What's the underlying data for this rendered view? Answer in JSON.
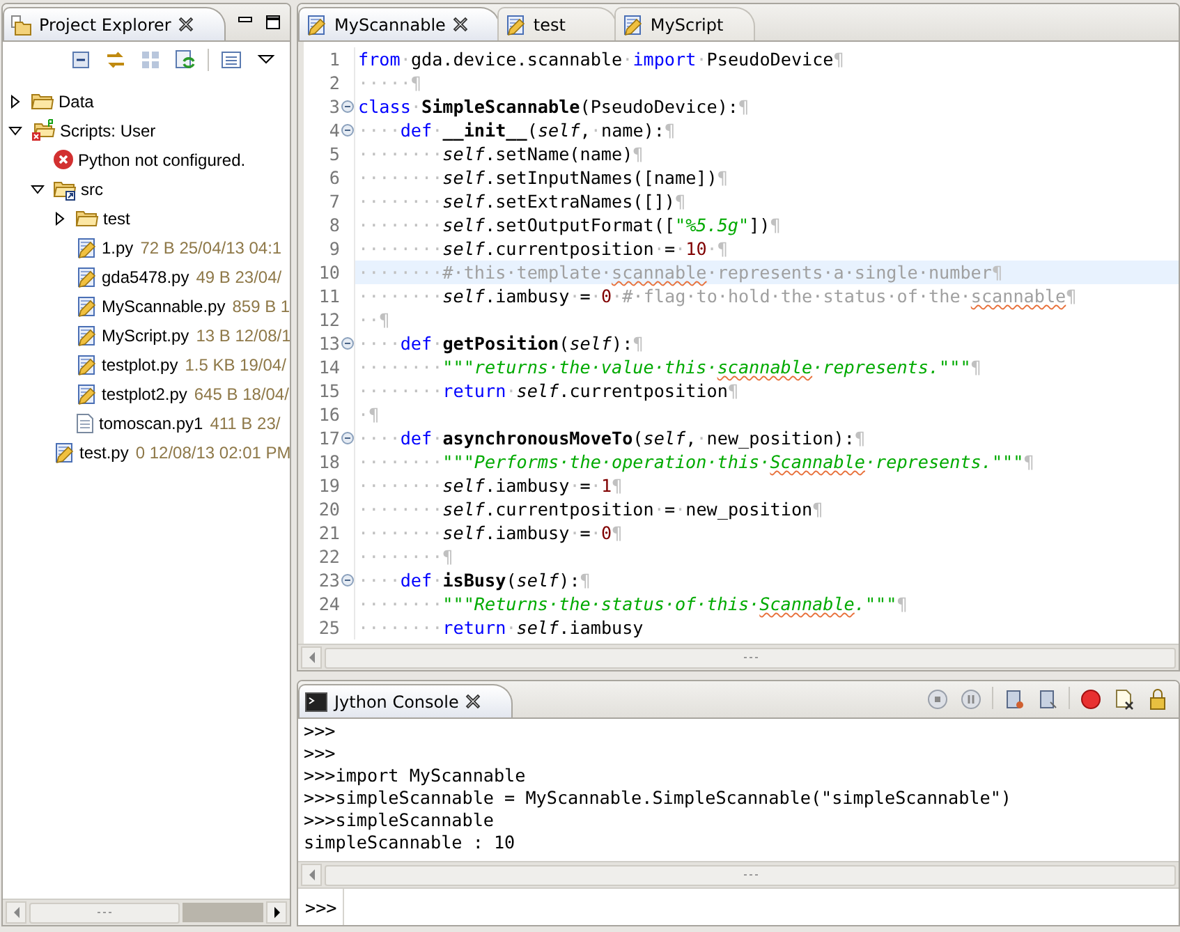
{
  "explorer": {
    "title": "Project Explorer",
    "tree": [
      {
        "label": "Data",
        "kind": "folder",
        "expanded": false
      },
      {
        "label": "Scripts: User",
        "kind": "project",
        "expanded": true,
        "children": [
          {
            "label": "Python not configured.",
            "kind": "error"
          },
          {
            "label": "src",
            "kind": "source-folder",
            "expanded": true,
            "children": [
              {
                "label": "test",
                "kind": "folder",
                "expanded": false
              },
              {
                "label": "1.py",
                "detail": "72 B 25/04/13 04:1",
                "kind": "python-file"
              },
              {
                "label": "gda5478.py",
                "detail": "49 B 23/04/",
                "kind": "python-file"
              },
              {
                "label": "MyScannable.py",
                "detail": "859 B 1",
                "kind": "python-file"
              },
              {
                "label": "MyScript.py",
                "detail": "13 B 12/08/1",
                "kind": "python-file"
              },
              {
                "label": "testplot.py",
                "detail": "1.5 KB 19/04/",
                "kind": "python-file"
              },
              {
                "label": "testplot2.py",
                "detail": "645 B 18/04/",
                "kind": "python-file"
              },
              {
                "label": "tomoscan.py1",
                "detail": "411 B 23/",
                "kind": "text-file"
              }
            ]
          },
          {
            "label": "test.py",
            "detail": "0 12/08/13 02:01 PM",
            "kind": "python-file"
          }
        ]
      }
    ]
  },
  "editor": {
    "tabs": [
      {
        "label": "MyScannable",
        "selected": true
      },
      {
        "label": "test",
        "selected": false
      },
      {
        "label": "MyScript",
        "selected": false
      }
    ],
    "lines": [
      {
        "number": "1",
        "fold": false,
        "current": false,
        "tokens": [
          {
            "kind": "keyword",
            "text": "from"
          },
          {
            "kind": "space",
            "text": "·"
          },
          {
            "kind": "plain",
            "text": "gda.device.scannable"
          },
          {
            "kind": "space",
            "text": "·"
          },
          {
            "kind": "keyword",
            "text": "import"
          },
          {
            "kind": "space",
            "text": "·"
          },
          {
            "kind": "plain",
            "text": "PseudoDevice"
          },
          {
            "kind": "space",
            "text": "¶"
          }
        ]
      },
      {
        "number": "2",
        "fold": false,
        "current": false,
        "tokens": [
          {
            "kind": "space",
            "text": "·····¶"
          }
        ]
      },
      {
        "number": "3",
        "fold": true,
        "current": false,
        "tokens": [
          {
            "kind": "keyword",
            "text": "class"
          },
          {
            "kind": "space",
            "text": "·"
          },
          {
            "kind": "name",
            "text": "SimpleScannable"
          },
          {
            "kind": "plain",
            "text": "(PseudoDevice):"
          },
          {
            "kind": "space",
            "text": "¶"
          }
        ]
      },
      {
        "number": "4",
        "fold": true,
        "current": false,
        "tokens": [
          {
            "kind": "space",
            "text": "····"
          },
          {
            "kind": "keyword",
            "text": "def"
          },
          {
            "kind": "space",
            "text": "·"
          },
          {
            "kind": "name",
            "text": "__init__"
          },
          {
            "kind": "plain",
            "text": "("
          },
          {
            "kind": "self",
            "text": "self"
          },
          {
            "kind": "plain",
            "text": ","
          },
          {
            "kind": "space",
            "text": "·"
          },
          {
            "kind": "plain",
            "text": "name):"
          },
          {
            "kind": "space",
            "text": "¶"
          }
        ]
      },
      {
        "number": "5",
        "fold": false,
        "current": false,
        "tokens": [
          {
            "kind": "space",
            "text": "········"
          },
          {
            "kind": "self",
            "text": "self"
          },
          {
            "kind": "plain",
            "text": ".setName(name)"
          },
          {
            "kind": "space",
            "text": "¶"
          }
        ]
      },
      {
        "number": "6",
        "fold": false,
        "current": false,
        "tokens": [
          {
            "kind": "space",
            "text": "········"
          },
          {
            "kind": "self",
            "text": "self"
          },
          {
            "kind": "plain",
            "text": ".setInputNames([name])"
          },
          {
            "kind": "space",
            "text": "¶"
          }
        ]
      },
      {
        "number": "7",
        "fold": false,
        "current": false,
        "tokens": [
          {
            "kind": "space",
            "text": "········"
          },
          {
            "kind": "self",
            "text": "self"
          },
          {
            "kind": "plain",
            "text": ".setExtraNames([])"
          },
          {
            "kind": "space",
            "text": "¶"
          }
        ]
      },
      {
        "number": "8",
        "fold": false,
        "current": false,
        "tokens": [
          {
            "kind": "space",
            "text": "········"
          },
          {
            "kind": "self",
            "text": "self"
          },
          {
            "kind": "plain",
            "text": ".setOutputFormat(["
          },
          {
            "kind": "string",
            "text": "\"%5.5g\""
          },
          {
            "kind": "plain",
            "text": "])"
          },
          {
            "kind": "space",
            "text": "¶"
          }
        ]
      },
      {
        "number": "9",
        "fold": false,
        "current": false,
        "tokens": [
          {
            "kind": "space",
            "text": "········"
          },
          {
            "kind": "self",
            "text": "self"
          },
          {
            "kind": "plain",
            "text": ".currentposition"
          },
          {
            "kind": "space",
            "text": "·"
          },
          {
            "kind": "plain",
            "text": "="
          },
          {
            "kind": "space",
            "text": "·"
          },
          {
            "kind": "number",
            "text": "10"
          },
          {
            "kind": "space",
            "text": "·¶"
          }
        ]
      },
      {
        "number": "10",
        "fold": false,
        "current": true,
        "tokens": [
          {
            "kind": "space",
            "text": "········"
          },
          {
            "kind": "comment",
            "text": "#·this·template·"
          },
          {
            "kind": "comment-typo",
            "text": "scannable"
          },
          {
            "kind": "comment",
            "text": "·represents·a·single·number"
          },
          {
            "kind": "space",
            "text": "¶"
          }
        ]
      },
      {
        "number": "11",
        "fold": false,
        "current": false,
        "tokens": [
          {
            "kind": "space",
            "text": "········"
          },
          {
            "kind": "self",
            "text": "self"
          },
          {
            "kind": "plain",
            "text": ".iambusy"
          },
          {
            "kind": "space",
            "text": "·"
          },
          {
            "kind": "plain",
            "text": "="
          },
          {
            "kind": "space",
            "text": "·"
          },
          {
            "kind": "number",
            "text": "0"
          },
          {
            "kind": "space",
            "text": "·"
          },
          {
            "kind": "comment",
            "text": "#·flag·to·hold·the·status·of·the·"
          },
          {
            "kind": "comment-typo",
            "text": "scannable"
          },
          {
            "kind": "space",
            "text": "¶"
          }
        ]
      },
      {
        "number": "12",
        "fold": false,
        "current": false,
        "tokens": [
          {
            "kind": "space",
            "text": "··¶"
          }
        ]
      },
      {
        "number": "13",
        "fold": true,
        "current": false,
        "tokens": [
          {
            "kind": "space",
            "text": "····"
          },
          {
            "kind": "keyword",
            "text": "def"
          },
          {
            "kind": "space",
            "text": "·"
          },
          {
            "kind": "name",
            "text": "getPosition"
          },
          {
            "kind": "plain",
            "text": "("
          },
          {
            "kind": "self",
            "text": "self"
          },
          {
            "kind": "plain",
            "text": "):"
          },
          {
            "kind": "space",
            "text": "¶"
          }
        ]
      },
      {
        "number": "14",
        "fold": false,
        "current": false,
        "tokens": [
          {
            "kind": "space",
            "text": "········"
          },
          {
            "kind": "string",
            "text": "\"\"\"returns·the·value·this·"
          },
          {
            "kind": "string-typo",
            "text": "scannable"
          },
          {
            "kind": "string",
            "text": "·represents.\"\"\""
          },
          {
            "kind": "space",
            "text": "¶"
          }
        ]
      },
      {
        "number": "15",
        "fold": false,
        "current": false,
        "tokens": [
          {
            "kind": "space",
            "text": "········"
          },
          {
            "kind": "keyword",
            "text": "return"
          },
          {
            "kind": "space",
            "text": "·"
          },
          {
            "kind": "self",
            "text": "self"
          },
          {
            "kind": "plain",
            "text": ".currentposition"
          },
          {
            "kind": "space",
            "text": "¶"
          }
        ]
      },
      {
        "number": "16",
        "fold": false,
        "current": false,
        "tokens": [
          {
            "kind": "space",
            "text": "·¶"
          }
        ]
      },
      {
        "number": "17",
        "fold": true,
        "current": false,
        "tokens": [
          {
            "kind": "space",
            "text": "····"
          },
          {
            "kind": "keyword",
            "text": "def"
          },
          {
            "kind": "space",
            "text": "·"
          },
          {
            "kind": "name",
            "text": "asynchronousMoveTo"
          },
          {
            "kind": "plain",
            "text": "("
          },
          {
            "kind": "self",
            "text": "self"
          },
          {
            "kind": "plain",
            "text": ","
          },
          {
            "kind": "space",
            "text": "·"
          },
          {
            "kind": "plain",
            "text": "new_position):"
          },
          {
            "kind": "space",
            "text": "¶"
          }
        ]
      },
      {
        "number": "18",
        "fold": false,
        "current": false,
        "tokens": [
          {
            "kind": "space",
            "text": "········"
          },
          {
            "kind": "string",
            "text": "\"\"\"Performs·the·operation·this·"
          },
          {
            "kind": "string-typo",
            "text": "Scannable"
          },
          {
            "kind": "string",
            "text": "·represents.\"\"\""
          },
          {
            "kind": "space",
            "text": "¶"
          }
        ]
      },
      {
        "number": "19",
        "fold": false,
        "current": false,
        "tokens": [
          {
            "kind": "space",
            "text": "········"
          },
          {
            "kind": "self",
            "text": "self"
          },
          {
            "kind": "plain",
            "text": ".iambusy"
          },
          {
            "kind": "space",
            "text": "·"
          },
          {
            "kind": "plain",
            "text": "="
          },
          {
            "kind": "space",
            "text": "·"
          },
          {
            "kind": "number",
            "text": "1"
          },
          {
            "kind": "space",
            "text": "¶"
          }
        ]
      },
      {
        "number": "20",
        "fold": false,
        "current": false,
        "tokens": [
          {
            "kind": "space",
            "text": "········"
          },
          {
            "kind": "self",
            "text": "self"
          },
          {
            "kind": "plain",
            "text": ".currentposition"
          },
          {
            "kind": "space",
            "text": "·"
          },
          {
            "kind": "plain",
            "text": "="
          },
          {
            "kind": "space",
            "text": "·"
          },
          {
            "kind": "plain",
            "text": "new_position"
          },
          {
            "kind": "space",
            "text": "¶"
          }
        ]
      },
      {
        "number": "21",
        "fold": false,
        "current": false,
        "tokens": [
          {
            "kind": "space",
            "text": "········"
          },
          {
            "kind": "self",
            "text": "self"
          },
          {
            "kind": "plain",
            "text": ".iambusy"
          },
          {
            "kind": "space",
            "text": "·"
          },
          {
            "kind": "plain",
            "text": "="
          },
          {
            "kind": "space",
            "text": "·"
          },
          {
            "kind": "number",
            "text": "0"
          },
          {
            "kind": "space",
            "text": "¶"
          }
        ]
      },
      {
        "number": "22",
        "fold": false,
        "current": false,
        "tokens": [
          {
            "kind": "space",
            "text": "········¶"
          }
        ]
      },
      {
        "number": "23",
        "fold": true,
        "current": false,
        "tokens": [
          {
            "kind": "space",
            "text": "····"
          },
          {
            "kind": "keyword",
            "text": "def"
          },
          {
            "kind": "space",
            "text": "·"
          },
          {
            "kind": "name",
            "text": "isBusy"
          },
          {
            "kind": "plain",
            "text": "("
          },
          {
            "kind": "self",
            "text": "self"
          },
          {
            "kind": "plain",
            "text": "):"
          },
          {
            "kind": "space",
            "text": "¶"
          }
        ]
      },
      {
        "number": "24",
        "fold": false,
        "current": false,
        "tokens": [
          {
            "kind": "space",
            "text": "········"
          },
          {
            "kind": "string",
            "text": "\"\"\"Returns·the·status·of·this·"
          },
          {
            "kind": "string-typo",
            "text": "Scannable"
          },
          {
            "kind": "string",
            "text": ".\"\"\""
          },
          {
            "kind": "space",
            "text": "¶"
          }
        ]
      },
      {
        "number": "25",
        "fold": false,
        "current": false,
        "tokens": [
          {
            "kind": "space",
            "text": "········"
          },
          {
            "kind": "keyword",
            "text": "return"
          },
          {
            "kind": "space",
            "text": "·"
          },
          {
            "kind": "self",
            "text": "self"
          },
          {
            "kind": "plain",
            "text": ".iambusy"
          }
        ]
      }
    ]
  },
  "console": {
    "title": "Jython Console",
    "lines": [
      ">>>",
      ">>>",
      ">>>import MyScannable",
      ">>>simpleScannable = MyScannable.SimpleScannable(\"simpleScannable\")",
      ">>>simpleScannable",
      "simpleScannable : 10"
    ],
    "prompt": ">>>"
  }
}
